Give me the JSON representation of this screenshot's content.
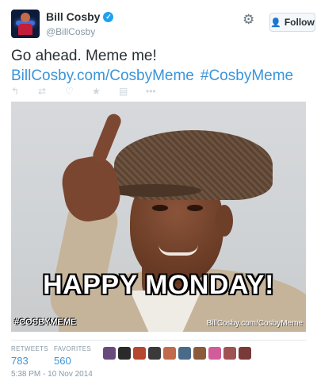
{
  "header": {
    "display_name": "Bill Cosby",
    "handle": "@BillCosby",
    "follow_label": "Follow"
  },
  "tweet": {
    "text": "Go ahead. Meme me!",
    "link": "BillCosby.com/CosbyMeme",
    "hashtag": "#CosbyMeme"
  },
  "actions": [
    {
      "name": "reply-icon",
      "glyph": "↰"
    },
    {
      "name": "retweet-icon",
      "glyph": "⇄"
    },
    {
      "name": "favorite-heart-icon",
      "glyph": "♡"
    },
    {
      "name": "star-icon",
      "glyph": "★"
    },
    {
      "name": "media-icon",
      "glyph": "▤"
    },
    {
      "name": "more-icon",
      "glyph": "•••"
    }
  ],
  "media": {
    "caption": "HAPPY MONDAY!",
    "tag": "#COSBYMEME",
    "url": "BillCosby.com/CosbyMeme"
  },
  "stats": {
    "retweets_label": "RETWEETS",
    "retweets": "783",
    "favorites_label": "FAVORITES",
    "favorites": "560"
  },
  "favoriter_colors": [
    "#6a4a7c",
    "#2a2a2a",
    "#b5472f",
    "#3a3a3a",
    "#c26a4d",
    "#4a6a8a",
    "#8a5a3a",
    "#d15c9a",
    "#a05252",
    "#7a3a3a"
  ],
  "timestamp": "5:38 PM - 10 Nov 2014",
  "colors": {
    "link": "#3b94d9",
    "verified": "#1da1f2",
    "muted": "#8899a6"
  }
}
